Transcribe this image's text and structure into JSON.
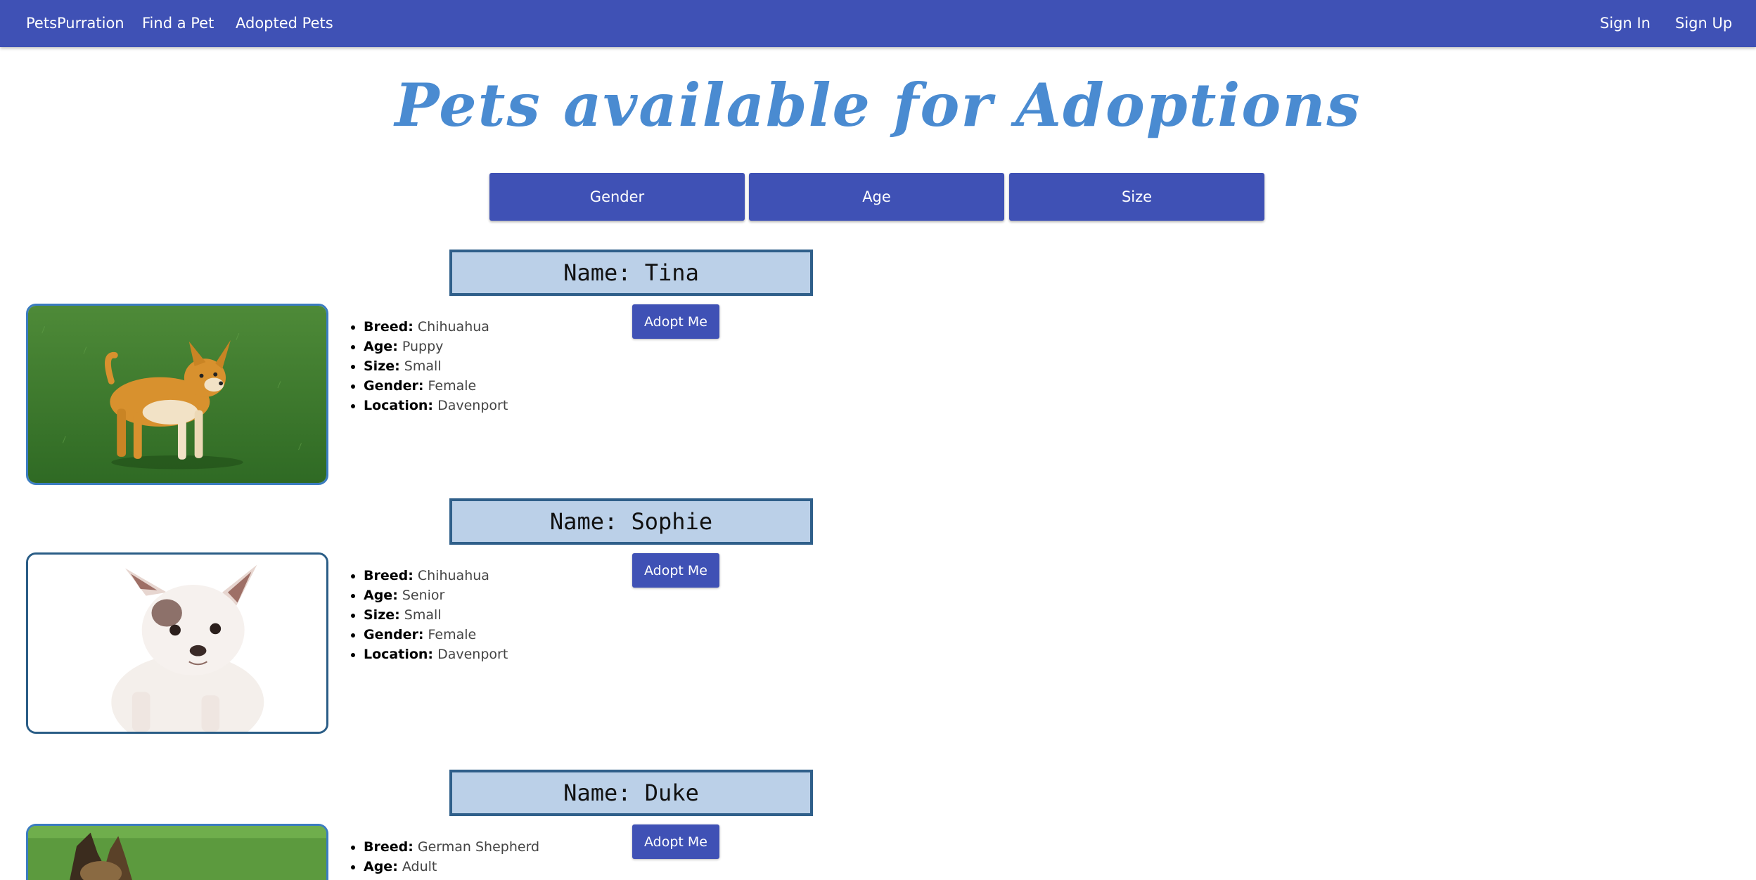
{
  "nav": {
    "brand": "PetsPurration",
    "find_pet": "Find a Pet",
    "adopted_pets": "Adopted Pets",
    "sign_in": "Sign In",
    "sign_up": "Sign Up"
  },
  "title": "Pets available for Adoptions",
  "filters": {
    "gender": "Gender",
    "age": "Age",
    "size": "Size"
  },
  "labels": {
    "breed": "Breed:",
    "age": "Age:",
    "size": "Size:",
    "gender": "Gender:",
    "location": "Location:",
    "adopt": "Adopt Me"
  },
  "pets": [
    {
      "name": "Name: Tina",
      "breed": "Chihuahua",
      "age": "Puppy",
      "size": "Small",
      "gender": "Female",
      "location": "Davenport"
    },
    {
      "name": "Name: Sophie",
      "breed": "Chihuahua",
      "age": "Senior",
      "size": "Small",
      "gender": "Female",
      "location": "Davenport"
    },
    {
      "name": "Name: Duke",
      "breed": "German Shepherd",
      "age": "Adult",
      "size": "",
      "gender": "",
      "location": ""
    }
  ],
  "colors": {
    "primary": "#3f51b5",
    "title": "#4a8bd1",
    "name_box_bg": "#bbd0e8",
    "name_box_border": "#2f5f8a",
    "photo_border": "#3b7cc0"
  }
}
